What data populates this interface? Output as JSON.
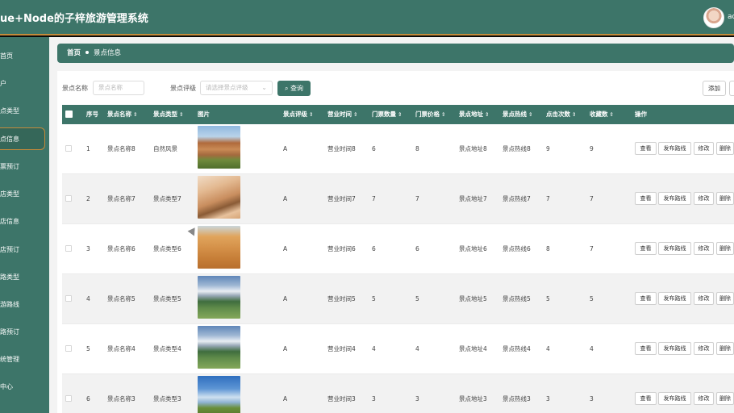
{
  "header": {
    "title": "ue+Node的子梓旅游管理系统",
    "user": "ad"
  },
  "sidebar": {
    "items": [
      {
        "label": "首页",
        "active": false
      },
      {
        "label": "户",
        "active": false
      },
      {
        "label": "点类型",
        "active": false
      },
      {
        "label": "点信息",
        "active": true
      },
      {
        "label": "票预订",
        "active": false
      },
      {
        "label": "店类型",
        "active": false
      },
      {
        "label": "店信息",
        "active": false
      },
      {
        "label": "店预订",
        "active": false
      },
      {
        "label": "路类型",
        "active": false
      },
      {
        "label": "游路线",
        "active": false
      },
      {
        "label": "路预订",
        "active": false
      },
      {
        "label": "统管理",
        "active": false
      },
      {
        "label": "中心",
        "active": false
      }
    ]
  },
  "breadcrumb": {
    "home": "首页",
    "current": "景点信息"
  },
  "search": {
    "name_label": "景点名称",
    "name_placeholder": "景点名称",
    "rating_label": "景点评级",
    "rating_placeholder": "请选择景点评级",
    "query_label": "查询",
    "add_label": "添加"
  },
  "table": {
    "columns": [
      "序号",
      "景点名称",
      "景点类型",
      "图片",
      "景点评级",
      "营业时间",
      "门票数量",
      "门票价格",
      "景点地址",
      "景点热线",
      "点击次数",
      "收藏数",
      "操作"
    ],
    "actions": [
      "查看",
      "发布路线",
      "修改",
      "删除"
    ],
    "rows": [
      {
        "index": "1",
        "name": "景点名称8",
        "type": "自然风景",
        "image": "canyon-landscape",
        "rating": "A",
        "hours": "营业时间8",
        "qty": "6",
        "price": "8",
        "address": "景点地址8",
        "hotline": "景点热线8",
        "clicks": "9",
        "favs": "9"
      },
      {
        "index": "2",
        "name": "景点名称7",
        "type": "景点类型7",
        "image": "desert-dunes",
        "rating": "A",
        "hours": "营业时间7",
        "qty": "7",
        "price": "7",
        "address": "景点地址7",
        "hotline": "景点热线7",
        "clicks": "7",
        "favs": "7"
      },
      {
        "index": "3",
        "name": "景点名称6",
        "type": "景点类型6",
        "image": "desert-sand",
        "rating": "A",
        "hours": "营业时间6",
        "qty": "6",
        "price": "6",
        "address": "景点地址6",
        "hotline": "景点热线6",
        "clicks": "8",
        "favs": "7"
      },
      {
        "index": "4",
        "name": "景点名称5",
        "type": "景点类型5",
        "image": "snow-mountain-yurts",
        "rating": "A",
        "hours": "营业时间5",
        "qty": "5",
        "price": "5",
        "address": "景点地址5",
        "hotline": "景点热线5",
        "clicks": "5",
        "favs": "5"
      },
      {
        "index": "5",
        "name": "景点名称4",
        "type": "景点类型4",
        "image": "snow-mountain-yurts",
        "rating": "A",
        "hours": "营业时间4",
        "qty": "4",
        "price": "4",
        "address": "景点地址4",
        "hotline": "景点热线4",
        "clicks": "4",
        "favs": "4"
      },
      {
        "index": "6",
        "name": "景点名称3",
        "type": "景点类型3",
        "image": "grassland-sky",
        "rating": "A",
        "hours": "营业时间3",
        "qty": "3",
        "price": "3",
        "address": "景点地址3",
        "hotline": "景点热线3",
        "clicks": "3",
        "favs": "3"
      }
    ]
  },
  "colors": {
    "primary": "#3d7569",
    "accent": "#c48a3a"
  }
}
